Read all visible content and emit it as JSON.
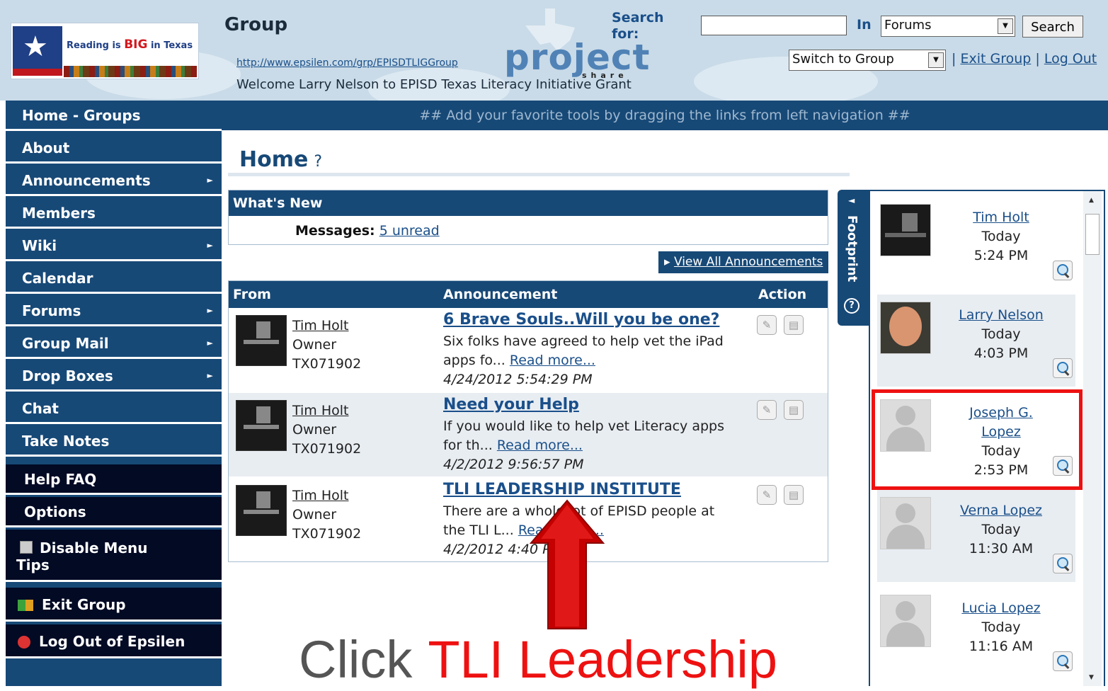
{
  "header": {
    "logo_text_pre": "Reading is",
    "logo_text_big": "BIG",
    "logo_text_post": "in Texas",
    "group_title": "Group",
    "group_url": "http://www.epsilen.com/grp/EPISDTLIGGroup",
    "welcome": "Welcome Larry Nelson to EPISD Texas Literacy Initiative Grant",
    "brand": "project",
    "brand_sub": "share",
    "search_label": "Search for:",
    "search_value": "",
    "in_label": "In",
    "in_select": "Forums",
    "search_button": "Search",
    "switch_select": "Switch to Group",
    "exit_group": "Exit Group",
    "log_out": "Log Out"
  },
  "banner": "## Add your favorite tools by dragging the links from left navigation ##",
  "sidebar": {
    "items": [
      {
        "label": "Home - Groups"
      },
      {
        "label": "About"
      },
      {
        "label": "Announcements",
        "submenu": true
      },
      {
        "label": "Members"
      },
      {
        "label": "Wiki",
        "submenu": true
      },
      {
        "label": "Calendar"
      },
      {
        "label": "Forums",
        "submenu": true
      },
      {
        "label": "Group Mail",
        "submenu": true
      },
      {
        "label": "Drop Boxes",
        "submenu": true
      },
      {
        "label": "Chat"
      },
      {
        "label": "Take Notes"
      }
    ],
    "help_faq": "Help FAQ",
    "options": "Options",
    "disable_tips_line1": "Disable Menu",
    "disable_tips_line2": "Tips",
    "exit_group": "Exit Group",
    "log_out": "Log Out of Epsilen"
  },
  "main": {
    "title": "Home",
    "help_icon": "question-circle-icon",
    "whats_new": {
      "heading": "What's New",
      "messages_label": "Messages:",
      "messages_value": "5 unread"
    },
    "view_all": "View All Announcements",
    "announcements": {
      "columns": {
        "from": "From",
        "announcement": "Announcement",
        "action": "Action"
      },
      "rows": [
        {
          "name": "Tim Holt",
          "role": "Owner",
          "id": "TX071902",
          "title": "6 Brave Souls..Will you be one?",
          "body_line1": "Six folks have agreed to help vet the iPad",
          "body_line2": "apps fo...",
          "read_more": "Read more...",
          "date": "4/24/2012 5:54:29 PM"
        },
        {
          "name": "Tim Holt",
          "role": "Owner",
          "id": "TX071902",
          "title": "Need your Help",
          "body_line1": "If you would like to help vet Literacy apps",
          "body_line2": "for th...",
          "read_more": "Read more...",
          "date": "4/2/2012 9:56:57 PM"
        },
        {
          "name": "Tim Holt",
          "role": "Owner",
          "id": "TX071902",
          "title": "TLI LEADERSHIP INSTITUTE",
          "body_line1": "There are a whole lot of EPISD people at",
          "body_line2": "the TLI L...",
          "read_more": "Read more...",
          "date": "4/2/2012 4:40 PM"
        }
      ]
    }
  },
  "footprint": {
    "tab_label": "Footprint",
    "items": [
      {
        "name": "Tim Holt",
        "day": "Today",
        "time": "5:24 PM"
      },
      {
        "name": "Larry Nelson",
        "day": "Today",
        "time": "4:03 PM"
      },
      {
        "name": "Joseph G. Lopez",
        "day": "Today",
        "time": "2:53 PM"
      },
      {
        "name": "Verna Lopez",
        "day": "Today",
        "time": "11:30 AM"
      },
      {
        "name": "Lucia Lopez",
        "day": "Today",
        "time": "11:16 AM"
      }
    ]
  },
  "overlay": {
    "caption_word": "Click",
    "caption_target": "TLI Leadership",
    "colors": {
      "arrow": "#cc0000",
      "highlight": "#ee1111",
      "caption_target": "#ee1111"
    }
  },
  "colors": {
    "nav_blue": "#174977",
    "nav_dark": "#020a24",
    "header_bg": "#c9dbe8",
    "link": "#1a4f8a"
  }
}
